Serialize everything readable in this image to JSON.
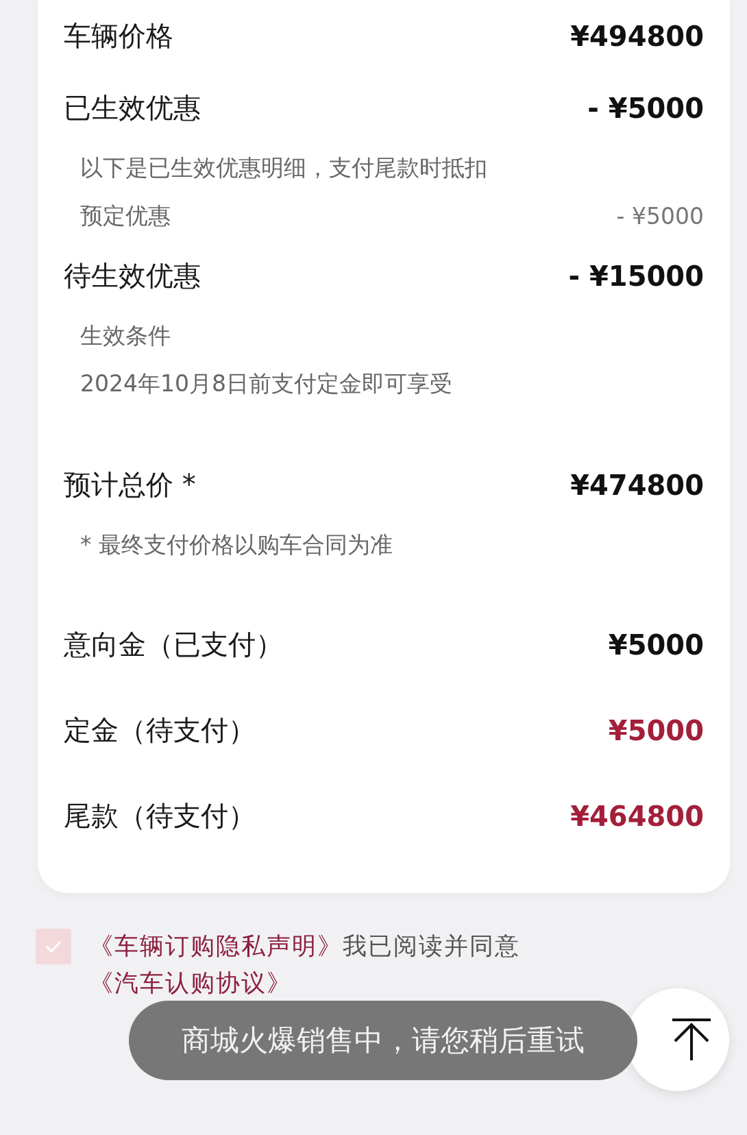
{
  "summary": [
    {
      "kind": "heading",
      "label": "车辆价格",
      "amount": "¥494800"
    },
    {
      "kind": "heading",
      "label": "已生效优惠",
      "amount": "- ¥5000"
    },
    {
      "kind": "note",
      "label": "以下是已生效优惠明细，支付尾款时抵扣"
    },
    {
      "kind": "item",
      "label": "预定优惠",
      "amount": "- ¥5000"
    },
    {
      "kind": "heading",
      "label": "待生效优惠",
      "amount": "- ¥15000"
    },
    {
      "kind": "note",
      "label": "生效条件"
    },
    {
      "kind": "note",
      "label": "2024年10月8日前支付定金即可享受"
    },
    {
      "kind": "total",
      "label": "预计总价 *",
      "amount": "¥474800"
    },
    {
      "kind": "note",
      "label": "* 最终支付价格以购车合同为准"
    }
  ],
  "payments": [
    {
      "label": "意向金（已支付）",
      "amount": "¥5000",
      "pending": false
    },
    {
      "label": "定金（待支付）",
      "amount": "¥5000",
      "pending": true
    },
    {
      "label": "尾款（待支付）",
      "amount": "¥464800",
      "pending": true
    }
  ],
  "agreement": {
    "checked": true,
    "parts": [
      {
        "kind": "link",
        "text": "《车辆订购隐私声明》"
      },
      {
        "kind": "text",
        "text": "我已阅读并同意"
      },
      {
        "kind": "link",
        "text": "《汽车认购协议》"
      }
    ]
  },
  "toast": {
    "text": "商城火爆销售中，请您稍后重试"
  }
}
